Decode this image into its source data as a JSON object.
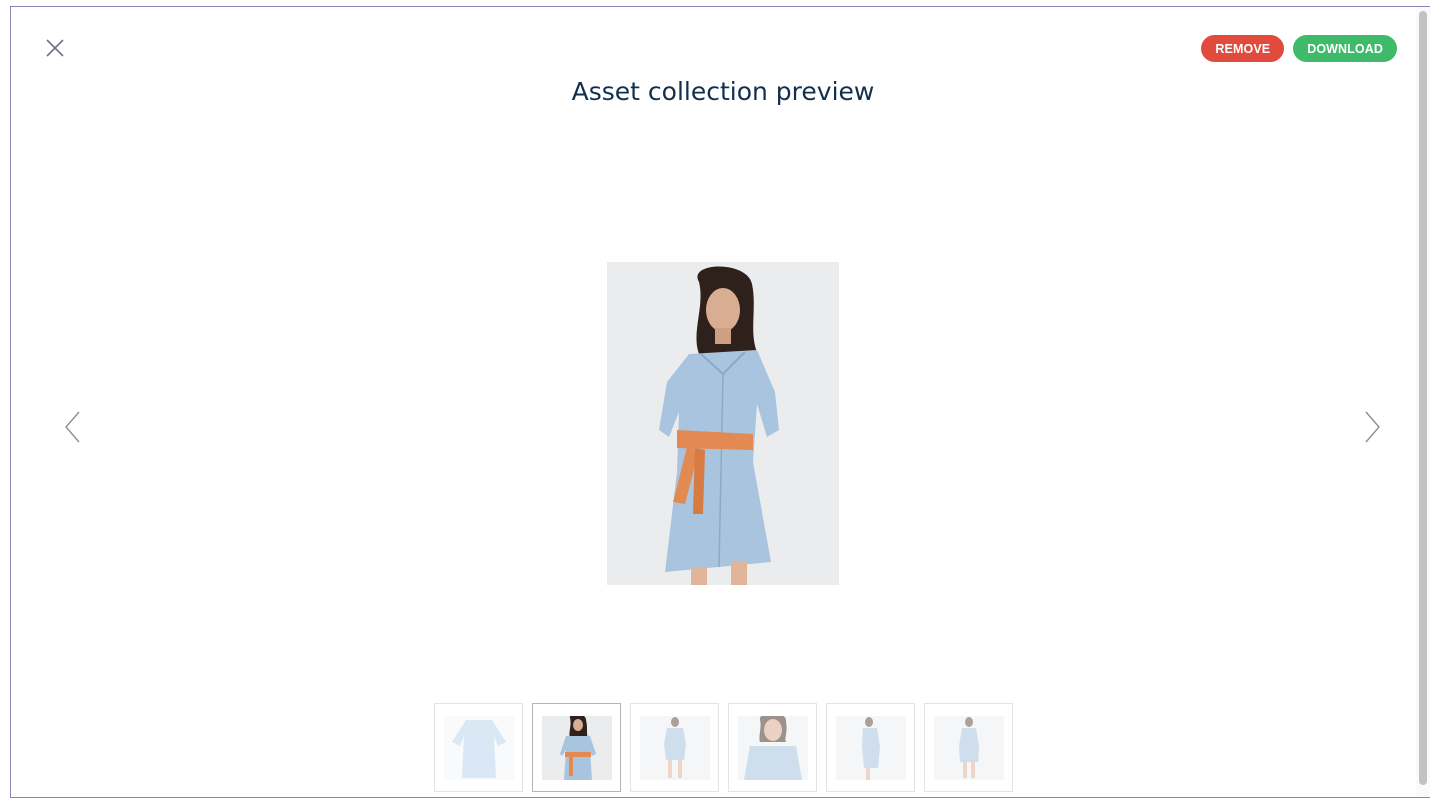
{
  "modal": {
    "title": "Asset collection preview",
    "close_icon": "close-icon",
    "remove_label": "REMOVE",
    "download_label": "DOWNLOAD",
    "prev_icon": "chevron-left-icon",
    "next_icon": "chevron-right-icon"
  },
  "colors": {
    "title": "#12304d",
    "remove": "#e14b3e",
    "download": "#3fba6a",
    "frame_border": "#8c82b4"
  },
  "gallery": {
    "selected_index": 1,
    "thumbnails": [
      {
        "depicts": "flat-lay-dress"
      },
      {
        "depicts": "model-front-belted"
      },
      {
        "depicts": "model-full-front"
      },
      {
        "depicts": "model-closeup"
      },
      {
        "depicts": "model-side"
      },
      {
        "depicts": "model-back"
      }
    ]
  }
}
